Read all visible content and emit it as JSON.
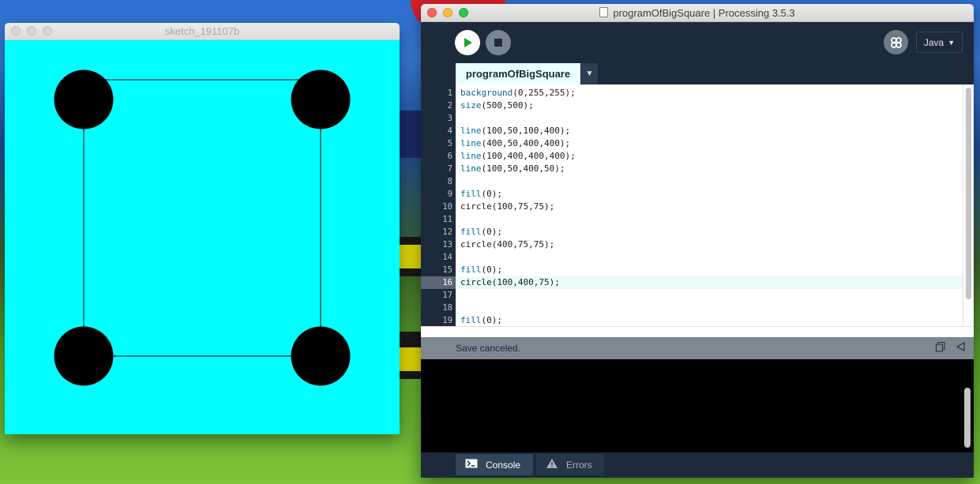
{
  "sketch_window": {
    "title": "sketch_191107b",
    "canvas_background": "#00ffff"
  },
  "ide_window": {
    "title": "programOfBigSquare | Processing 3.5.3",
    "toolbar": {
      "run_icon": "play-icon",
      "stop_icon": "stop-icon",
      "mode_icon": "debugger-icon",
      "mode_label": "Java"
    },
    "tabs": [
      {
        "label": "programOfBigSquare",
        "active": true
      }
    ],
    "editor": {
      "current_line": 16,
      "lines": [
        {
          "no": "1",
          "fn": "background",
          "args": "(0,255,255);"
        },
        {
          "no": "2",
          "fn": "size",
          "args": "(500,500);"
        },
        {
          "no": "3",
          "fn": "",
          "args": ""
        },
        {
          "no": "4",
          "fn": "line",
          "args": "(100,50,100,400);"
        },
        {
          "no": "5",
          "fn": "line",
          "args": "(400,50,400,400);"
        },
        {
          "no": "6",
          "fn": "line",
          "args": "(100,400,400,400);"
        },
        {
          "no": "7",
          "fn": "line",
          "args": "(100,50,400,50);"
        },
        {
          "no": "8",
          "fn": "",
          "args": ""
        },
        {
          "no": "9",
          "fn": "fill",
          "args": "(0);"
        },
        {
          "no": "10",
          "fn": "",
          "args": "circle(100,75,75);"
        },
        {
          "no": "11",
          "fn": "",
          "args": ""
        },
        {
          "no": "12",
          "fn": "fill",
          "args": "(0);"
        },
        {
          "no": "13",
          "fn": "",
          "args": "circle(400,75,75);"
        },
        {
          "no": "14",
          "fn": "",
          "args": ""
        },
        {
          "no": "15",
          "fn": "fill",
          "args": "(0);"
        },
        {
          "no": "16",
          "fn": "",
          "args": "circle(100,400,75);"
        },
        {
          "no": "17",
          "fn": "",
          "args": ""
        },
        {
          "no": "18",
          "fn": "",
          "args": ""
        },
        {
          "no": "19",
          "fn": "fill",
          "args": "(0);"
        }
      ]
    },
    "status": {
      "message": "Save canceled.",
      "copy_icon": "copy-icon",
      "collapse_icon": "collapse-triangle-icon"
    },
    "bottom_tabs": {
      "console_label": "Console",
      "errors_label": "Errors"
    },
    "colors": {
      "keyword": "#006699",
      "window_bg": "#1c2a3c",
      "tab_active_bg": "#eaffff"
    }
  }
}
